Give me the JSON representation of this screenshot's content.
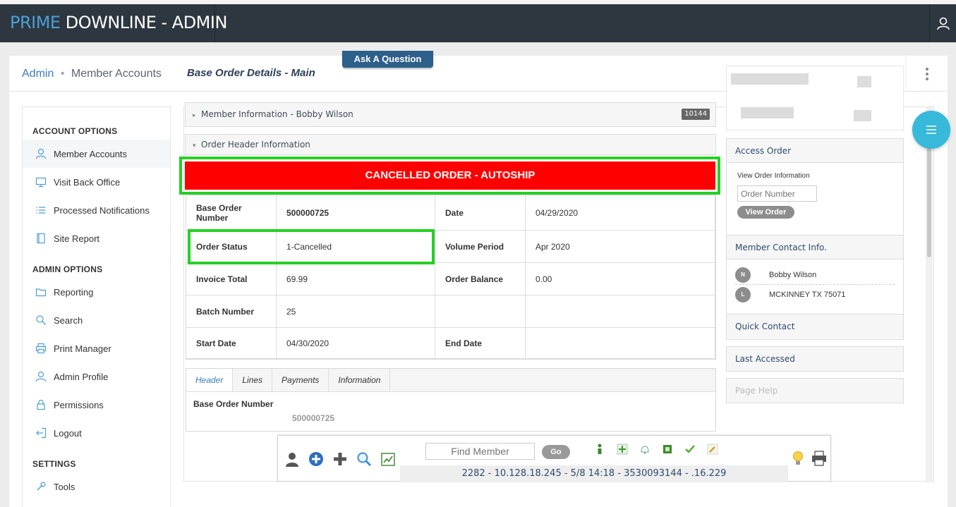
{
  "brand": {
    "part1": "PRIME",
    "part2": " DOWNLINE - ADMIN"
  },
  "breadcrumb": {
    "root": "Admin",
    "separator": "•",
    "current": "Member Accounts"
  },
  "sidebar": {
    "account_heading": "ACCOUNT OPTIONS",
    "account_items": [
      {
        "label": "Member Accounts",
        "icon": "user-icon"
      },
      {
        "label": "Visit Back Office",
        "icon": "monitor-icon"
      },
      {
        "label": "Processed Notifications",
        "icon": "list-icon"
      },
      {
        "label": "Site Report",
        "icon": "document-icon"
      }
    ],
    "admin_heading": "ADMIN OPTIONS",
    "admin_items": [
      {
        "label": "Reporting",
        "icon": "folder-icon"
      },
      {
        "label": "Search",
        "icon": "search-icon"
      },
      {
        "label": "Print Manager",
        "icon": "printer-icon"
      },
      {
        "label": "Admin Profile",
        "icon": "user-icon"
      },
      {
        "label": "Permissions",
        "icon": "lock-icon"
      },
      {
        "label": "Logout",
        "icon": "logout-icon"
      }
    ],
    "settings_heading": "SETTINGS",
    "settings_items": [
      {
        "label": "Tools",
        "icon": "tools-icon"
      }
    ]
  },
  "ask_button": "Ask A Question",
  "section_title": "Base Order Details - Main",
  "member_info": {
    "label": "Member Information - Bobby Wilson",
    "badge": "10144"
  },
  "order_header": {
    "label": "Order Header Information"
  },
  "cancel_banner": "CANCELLED ORDER - AUTOSHIP",
  "order": {
    "base_order_label": "Base Order Number",
    "base_order_value": "500000725",
    "date_label": "Date",
    "date_value": "04/29/2020",
    "status_label": "Order Status",
    "status_value": "1-Cancelled",
    "volume_label": "Volume Period",
    "volume_value": "Apr 2020",
    "invoice_label": "Invoice Total",
    "invoice_value": "69.99",
    "balance_label": "Order Balance",
    "balance_value": "0.00",
    "batch_label": "Batch Number",
    "batch_value": "25",
    "start_label": "Start Date",
    "start_value": "04/30/2020",
    "end_label": "End Date",
    "end_value": ""
  },
  "tabs": {
    "items": [
      "Header",
      "Lines",
      "Payments",
      "Information"
    ],
    "active": "Header",
    "body_label": "Base Order Number",
    "body_value": "500000725"
  },
  "right": {
    "access_title": "Access Order",
    "view_order_info": "View Order Information",
    "order_number_placeholder": "Order Number",
    "view_order_button": "View Order",
    "contact_title": "Member Contact Info.",
    "contact_name_badge": "N",
    "contact_name": "Bobby Wilson",
    "contact_location_badge": "L",
    "contact_location": "MCKINNEY TX 75071",
    "quick_contact": "Quick Contact",
    "last_accessed": "Last Accessed",
    "page_help": "Page Help"
  },
  "toolbar": {
    "find_member_placeholder": "Find Member",
    "go_button": "Go",
    "status_line": "2282 - 10.128.18.245 - 5/8 14:18 - 3530093144 - .16.229"
  },
  "colors": {
    "accent": "#2d5f8b",
    "cancel": "#ff0000",
    "highlight": "#25d025",
    "fab": "#37b9d9"
  }
}
